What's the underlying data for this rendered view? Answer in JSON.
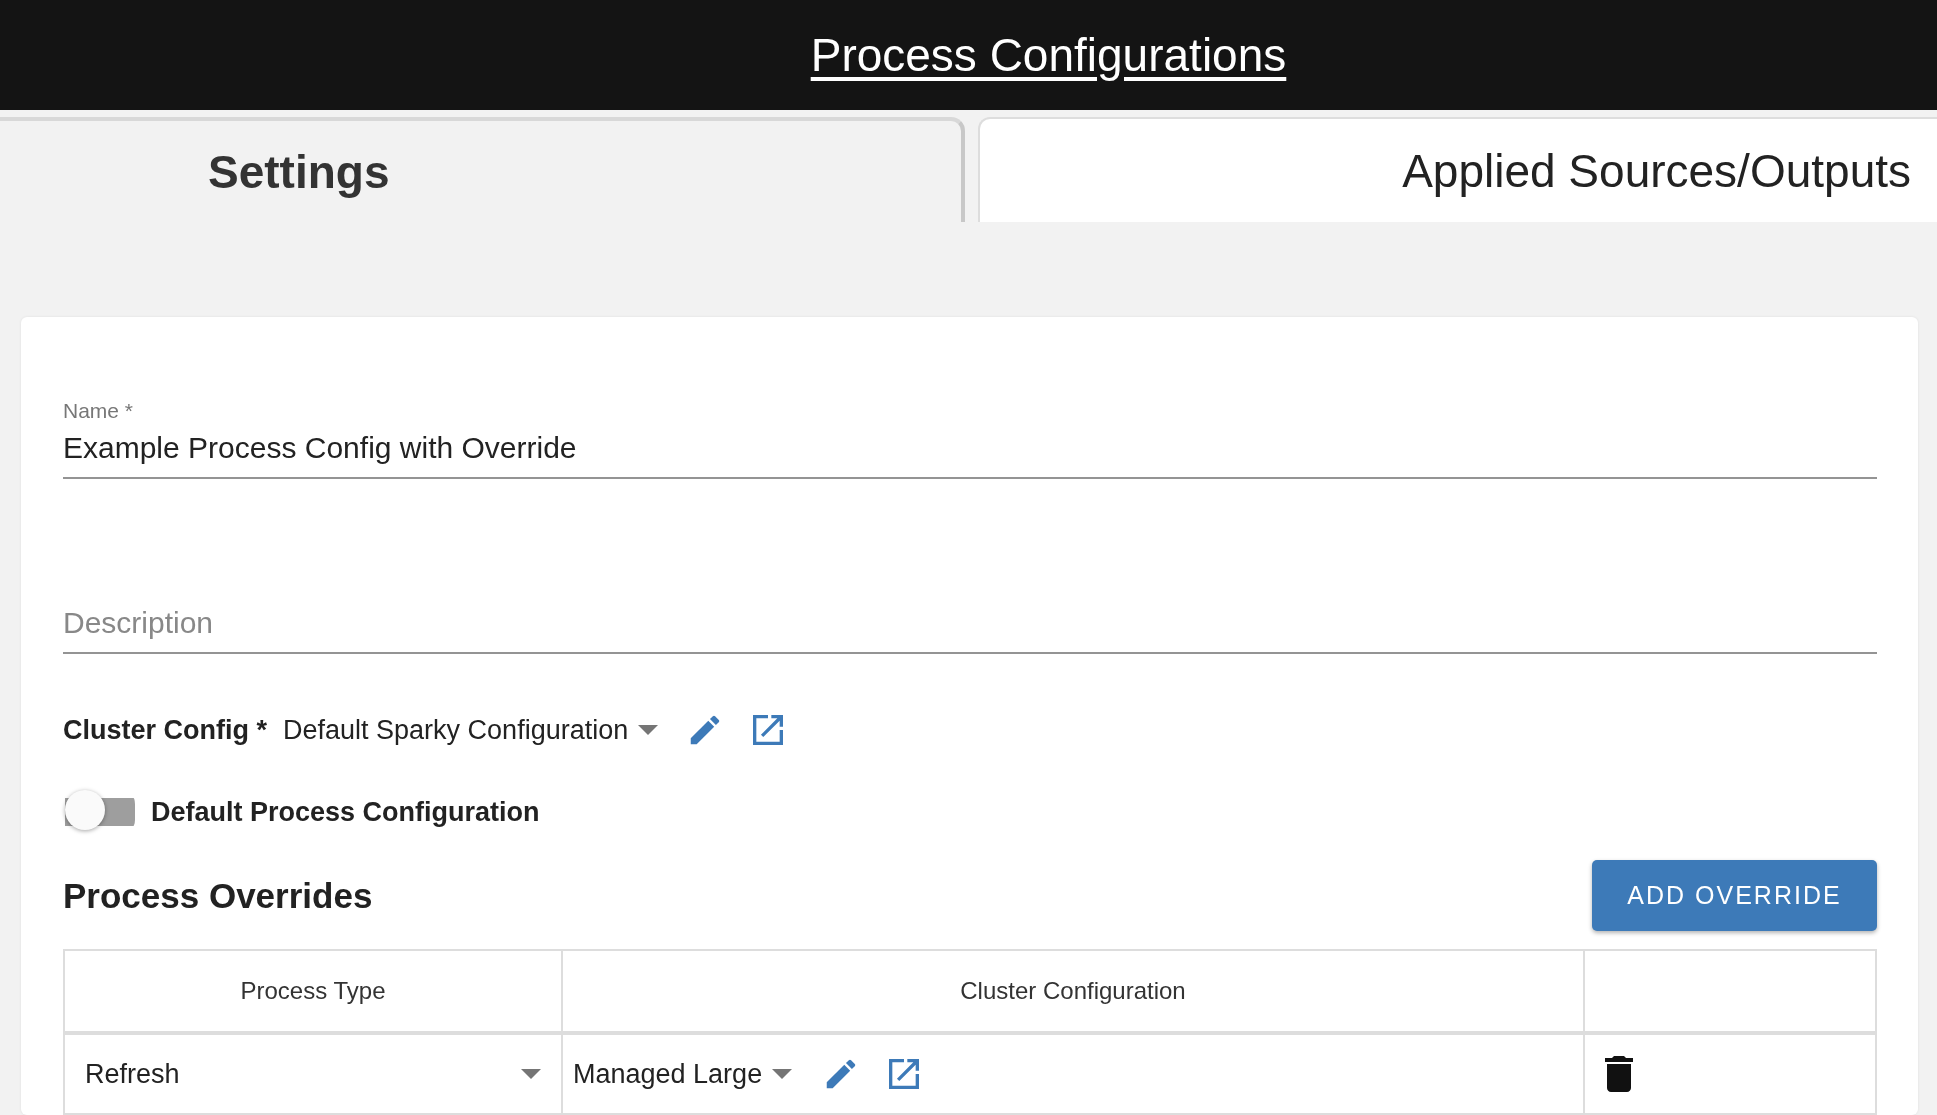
{
  "header": {
    "title": "Process Configurations"
  },
  "tabs": [
    {
      "label": "Settings",
      "selected": true
    },
    {
      "label": "Applied Sources/Outputs",
      "selected": false
    }
  ],
  "form": {
    "name": {
      "label": "Name *",
      "value": "Example Process Config with Override"
    },
    "description": {
      "placeholder": "Description"
    },
    "cluster_config": {
      "label": "Cluster Config *",
      "value": "Default Sparky Configuration"
    },
    "default_toggle": {
      "label": "Default Process Configuration",
      "on": false
    }
  },
  "overrides": {
    "title": "Process Overrides",
    "add_button": "ADD OVERRIDE",
    "columns": [
      "Process Type",
      "Cluster Configuration"
    ],
    "rows": [
      {
        "process_type": "Refresh",
        "cluster_configuration": "Managed Large"
      }
    ]
  }
}
